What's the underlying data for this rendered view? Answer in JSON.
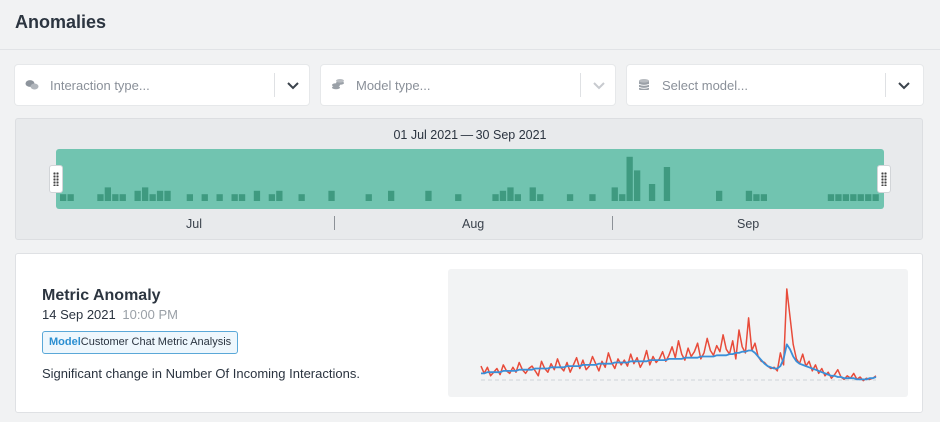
{
  "page": {
    "title": "Anomalies"
  },
  "filters": [
    {
      "icon": "chat-bubbles-icon",
      "placeholder": "Interaction type...",
      "enabled": true
    },
    {
      "icon": "coins-stack-icon",
      "placeholder": "Model type...",
      "enabled": false
    },
    {
      "icon": "database-icon",
      "placeholder": "Select model...",
      "enabled": true
    }
  ],
  "timeline": {
    "range_label": "01 Jul 2021 — 30 Sep 2021",
    "months": [
      "Jul",
      "Aug",
      "Sep"
    ],
    "brush_color": "#71c4b0",
    "bar_color": "#3f9a80",
    "daily_counts": [
      2,
      2,
      0,
      0,
      0,
      2,
      4,
      2,
      2,
      0,
      3,
      4,
      2,
      3,
      3,
      0,
      0,
      2,
      0,
      2,
      0,
      2,
      0,
      2,
      2,
      0,
      3,
      0,
      2,
      3,
      0,
      0,
      2,
      0,
      0,
      0,
      3,
      0,
      0,
      0,
      0,
      2,
      0,
      0,
      3,
      0,
      0,
      0,
      0,
      3,
      0,
      0,
      0,
      2,
      0,
      0,
      0,
      0,
      2,
      3,
      4,
      2,
      0,
      4,
      2,
      0,
      0,
      0,
      2,
      0,
      0,
      2,
      0,
      0,
      4,
      2,
      13,
      9,
      0,
      5,
      0,
      10,
      0,
      0,
      0,
      0,
      0,
      0,
      3,
      0,
      0,
      0,
      3,
      2,
      2,
      0,
      0,
      0,
      0,
      0,
      0,
      0,
      0,
      2,
      2,
      2,
      2,
      2,
      2,
      2
    ]
  },
  "anomaly": {
    "title": "Metric Anomaly",
    "date": "14 Sep 2021",
    "time": "10:00 PM",
    "badge_key": "Model",
    "badge_value": "Customer Chat Metric Analysis",
    "description": "Significant change in Number Of Incoming Interactions.",
    "colors": {
      "actual": "#e84b3a",
      "expected": "#3a8fd8",
      "baseline": "#cfd3d7"
    },
    "actual": [
      14,
      8,
      13,
      6,
      9,
      12,
      7,
      15,
      10,
      8,
      13,
      9,
      17,
      11,
      8,
      12,
      14,
      10,
      6,
      18,
      12,
      9,
      16,
      11,
      20,
      13,
      10,
      17,
      9,
      15,
      21,
      12,
      19,
      11,
      14,
      22,
      16,
      10,
      18,
      13,
      25,
      17,
      12,
      20,
      15,
      19,
      14,
      24,
      16,
      21,
      13,
      18,
      27,
      15,
      22,
      17,
      20,
      26,
      18,
      23,
      30,
      21,
      35,
      24,
      19,
      29,
      22,
      26,
      33,
      20,
      25,
      37,
      27,
      23,
      31,
      26,
      40,
      28,
      24,
      35,
      20,
      44,
      30,
      25,
      54,
      27,
      33,
      22,
      18,
      17,
      14,
      12,
      13,
      10,
      25,
      15,
      78,
      55,
      32,
      20,
      16,
      24,
      14,
      18,
      10,
      15,
      8,
      12,
      6,
      9,
      4,
      7,
      11,
      5,
      3,
      6,
      4,
      8,
      3,
      5,
      2,
      4,
      3,
      4,
      6
    ],
    "expected": [
      8,
      8,
      9,
      9,
      9,
      9,
      9,
      10,
      10,
      10,
      10,
      10,
      11,
      11,
      11,
      11,
      11,
      12,
      12,
      12,
      12,
      12,
      13,
      13,
      13,
      13,
      13,
      14,
      14,
      14,
      14,
      14,
      15,
      15,
      15,
      15,
      15,
      16,
      16,
      16,
      16,
      16,
      17,
      17,
      17,
      17,
      17,
      18,
      18,
      18,
      18,
      18,
      18,
      19,
      19,
      19,
      19,
      19,
      19,
      20,
      20,
      20,
      20,
      20,
      21,
      21,
      21,
      21,
      21,
      22,
      22,
      22,
      22,
      22,
      23,
      23,
      23,
      23,
      24,
      24,
      25,
      25,
      26,
      26,
      27,
      27,
      25,
      22,
      19,
      16,
      14,
      13,
      12,
      12,
      14,
      20,
      32,
      28,
      22,
      18,
      16,
      15,
      14,
      13,
      12,
      11,
      10,
      9,
      8,
      7,
      6,
      6,
      5,
      5,
      4,
      4,
      4,
      4,
      3,
      3,
      3,
      3,
      4,
      4,
      5
    ]
  }
}
